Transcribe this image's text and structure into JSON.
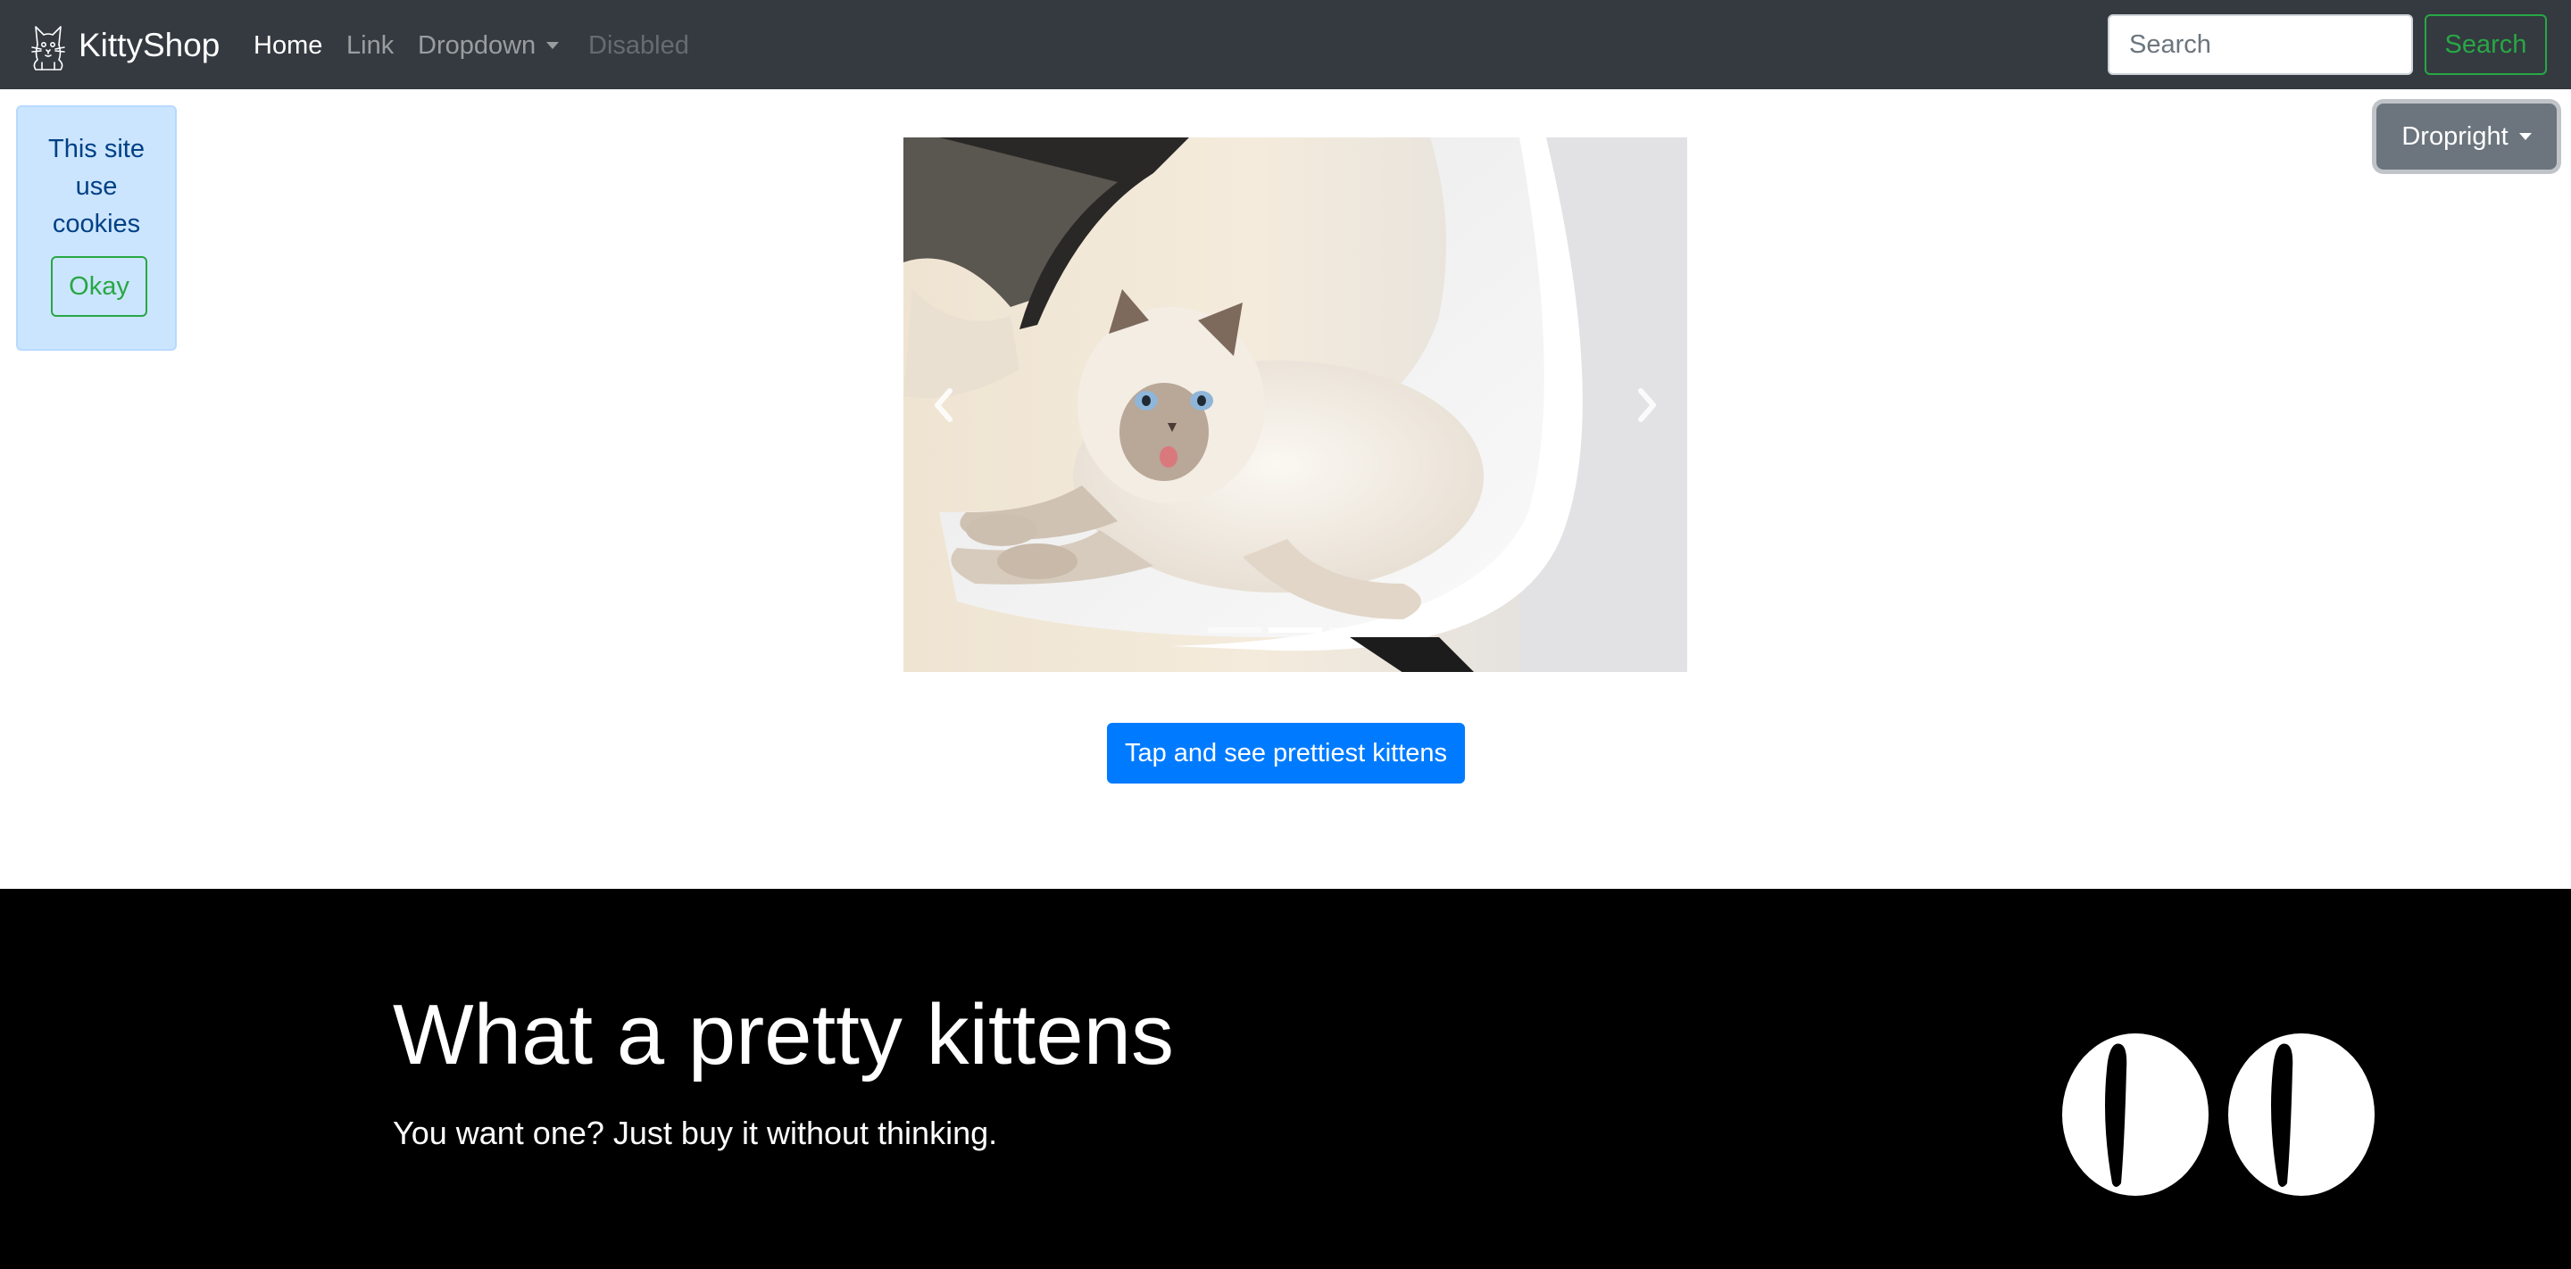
{
  "navbar": {
    "brand": "KittyShop",
    "links": [
      {
        "label": "Home",
        "state": "active"
      },
      {
        "label": "Link",
        "state": "normal"
      },
      {
        "label": "Dropdown",
        "state": "normal"
      },
      {
        "label": "Disabled",
        "state": "disabled"
      }
    ],
    "search_placeholder": "Search",
    "search_button": "Search"
  },
  "cookie_notice": {
    "text": "This site use cookies",
    "button": "Okay"
  },
  "dropright": {
    "label": "Dropright"
  },
  "carousel": {
    "slide_count": 3,
    "active_slide": 2
  },
  "cta": {
    "label": "Tap and see prettiest kittens"
  },
  "hero": {
    "title": "What a pretty kittens",
    "subtitle": "You want one? Just buy it without thinking."
  },
  "colors": {
    "navbar_bg": "#343a40",
    "success": "#28a745",
    "primary": "#007bff",
    "secondary": "#6c757d",
    "info_bg": "#cce5ff",
    "footer_bg": "#000000"
  },
  "icons": [
    "cat-logo-icon",
    "chevron-left-icon",
    "chevron-right-icon",
    "cat-eyes-icon",
    "caret-down-icon"
  ]
}
